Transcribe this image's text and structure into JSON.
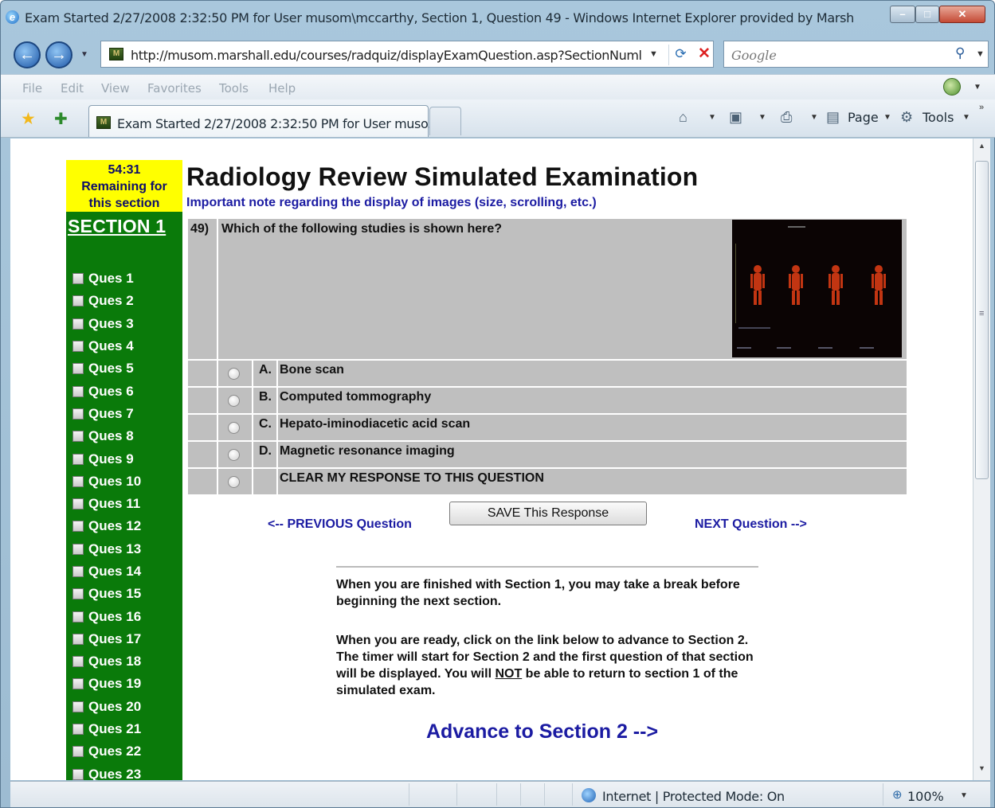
{
  "window": {
    "title": "Exam Started 2/27/2008 2:32:50 PM for User musom\\mccarthy, Section 1, Question 49 - Windows Internet Explorer provided by Marsh"
  },
  "address_bar": {
    "url": "http://musom.marshall.edu/courses/radquiz/displayExamQuestion.asp?SectionNuml",
    "search_placeholder": "Google"
  },
  "menu": [
    "File",
    "Edit",
    "View",
    "Favorites",
    "Tools",
    "Help"
  ],
  "tab": {
    "title": "Exam Started 2/27/2008 2:32:50 PM for User muso..."
  },
  "commands": {
    "page_label": "Page",
    "tools_label": "Tools"
  },
  "status": {
    "zone": "Internet | Protected Mode: On",
    "zoom": "100%"
  },
  "exam": {
    "timer_value": "54:31",
    "timer_line1": "Remaining for",
    "timer_line2": "this section",
    "section_label": "SECTION 1",
    "title": "Radiology Review Simulated Examination",
    "note_link": "Important note regarding the display of images (size, scrolling, etc.)",
    "question_number": "49)",
    "question_text": "Which of the following studies is shown here?",
    "options": [
      {
        "letter": "A.",
        "text": "Bone scan"
      },
      {
        "letter": "B.",
        "text": "Computed tommography"
      },
      {
        "letter": "C.",
        "text": "Hepato-iminodiacetic acid scan"
      },
      {
        "letter": "D.",
        "text": "Magnetic resonance imaging"
      }
    ],
    "clear_label": "CLEAR MY RESPONSE TO THIS QUESTION",
    "prev_link": "<-- PREVIOUS Question",
    "save_button": "SAVE This Response",
    "next_link": "NEXT Question -->",
    "finished_text_before": "When you are finished with Section ",
    "finished_section": "1",
    "finished_text_after": ", you may take a break before beginning the next section.",
    "ready_text_1": "When you are ready, click on the link below to advance to Section 2. The timer will start for Section 2 and the first question of that section will be displayed. You will ",
    "ready_not": "NOT",
    "ready_text_2": " be able to return to section ",
    "ready_section": "1",
    "ready_text_3": " of the simulated exam.",
    "advance_link": "Advance to Section 2 -->",
    "questions": [
      "Ques 1",
      "Ques 2",
      "Ques 3",
      "Ques 4",
      "Ques 5",
      "Ques 6",
      "Ques 7",
      "Ques 8",
      "Ques 9",
      "Ques 10",
      "Ques 11",
      "Ques 12",
      "Ques 13",
      "Ques 14",
      "Ques 15",
      "Ques 16",
      "Ques 17",
      "Ques 18",
      "Ques 19",
      "Ques 20",
      "Ques 21",
      "Ques 22",
      "Ques 23"
    ]
  },
  "colors": {
    "sidebar": "#0a7a0a",
    "timer_bg": "#ffff00",
    "link": "#1b1ba2",
    "question_bg": "#bfbfbf"
  }
}
